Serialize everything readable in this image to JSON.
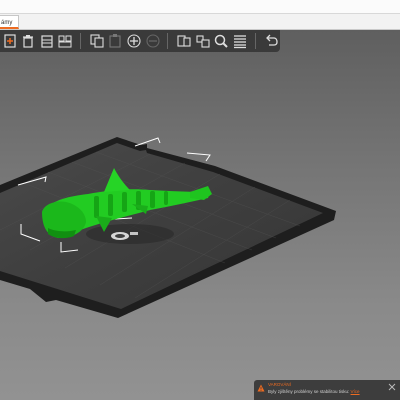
{
  "window": {
    "tab_label": "ámy"
  },
  "toolbar": {
    "icons": [
      "add-icon",
      "delete-icon",
      "delete-all-icon",
      "arrange-icon",
      "copy-icon",
      "paste-icon",
      "add-instance-icon",
      "remove-instance-icon",
      "split-objects-icon",
      "split-parts-icon",
      "search-icon",
      "layers-icon",
      "undo-icon"
    ]
  },
  "notification": {
    "title": "VAROVÁNÍ",
    "message": "Byly zjištěny problémy se stabilitou tisku:",
    "link_label": "Více"
  },
  "colors": {
    "accent": "#ed6b21",
    "model": "#1ee01e",
    "bed": "#2b2b2b",
    "toolbar": "#3a3a3a"
  }
}
